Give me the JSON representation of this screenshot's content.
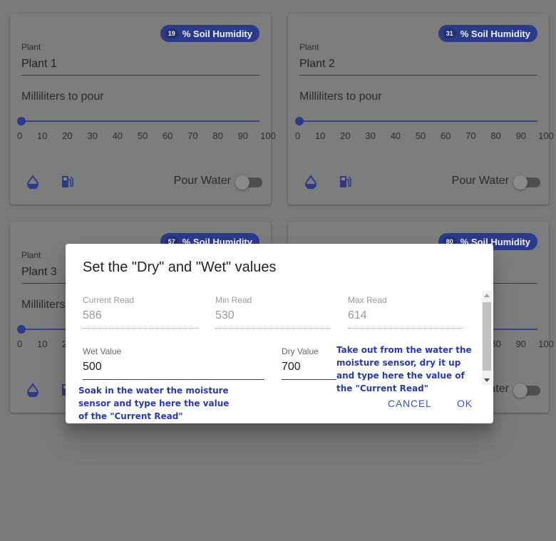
{
  "cards": [
    {
      "humidity_value": "19",
      "humidity_suffix": "% Soil Humidity",
      "plant_label": "Plant",
      "plant_name": "Plant 1",
      "ml_label": "Milliliters to pour",
      "pour_label": "Pour Water",
      "slider_value": 0
    },
    {
      "humidity_value": "31",
      "humidity_suffix": "% Soil Humidity",
      "plant_label": "Plant",
      "plant_name": "Plant 2",
      "ml_label": "Milliliters to pour",
      "pour_label": "Pour Water",
      "slider_value": 0
    },
    {
      "humidity_value": "57",
      "humidity_suffix": "% Soil Humidity",
      "plant_label": "Plant",
      "plant_name": "Plant 3",
      "ml_label": "Milliliters",
      "pour_label": "",
      "slider_value": 0
    },
    {
      "humidity_value": "80",
      "humidity_suffix": "% Soil Humidity",
      "plant_label": "",
      "plant_name": "",
      "ml_label": "",
      "pour_label": "ater",
      "slider_value": 0
    }
  ],
  "slider_ticks": [
    "0",
    "10",
    "20",
    "30",
    "40",
    "50",
    "60",
    "70",
    "80",
    "90",
    "100"
  ],
  "dialog": {
    "title": "Set the \"Dry\" and \"Wet\" values",
    "current_read_label": "Current Read",
    "current_read_value": "586",
    "min_read_label": "Min Read",
    "min_read_value": "530",
    "max_read_label": "Max Read",
    "max_read_value": "614",
    "wet_label": "Wet Value",
    "wet_value": "500",
    "dry_label": "Dry Value",
    "dry_value": "700",
    "cancel_label": "CANCEL",
    "ok_label": "OK"
  },
  "annotations": {
    "wet_help": "Soak in the water the moisture sensor and type here the value of the \"Current Read\"",
    "dry_help": "Take out from the water the moisture sensor, dry it up and type here the value of the \"Current Read\""
  },
  "colors": {
    "accent": "#3f51b5",
    "chip": "#2c3a8a",
    "annotation": "#2b3aa8"
  }
}
